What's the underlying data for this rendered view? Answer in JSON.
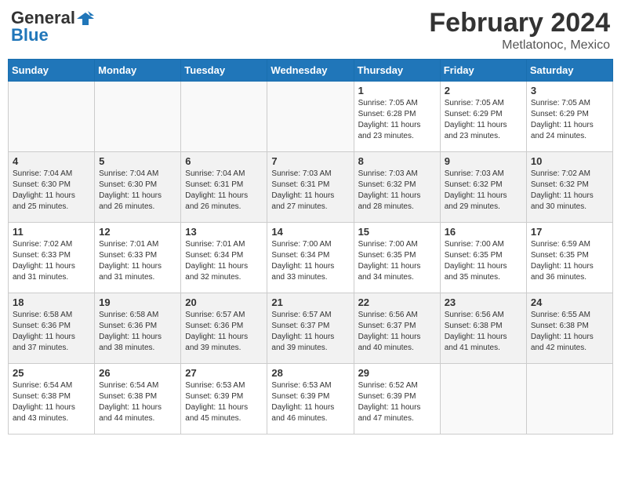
{
  "header": {
    "logo_line1": "General",
    "logo_line2": "Blue",
    "month_year": "February 2024",
    "location": "Metlatonoc, Mexico"
  },
  "weekdays": [
    "Sunday",
    "Monday",
    "Tuesday",
    "Wednesday",
    "Thursday",
    "Friday",
    "Saturday"
  ],
  "weeks": [
    [
      {
        "day": "",
        "info": ""
      },
      {
        "day": "",
        "info": ""
      },
      {
        "day": "",
        "info": ""
      },
      {
        "day": "",
        "info": ""
      },
      {
        "day": "1",
        "info": "Sunrise: 7:05 AM\nSunset: 6:28 PM\nDaylight: 11 hours\nand 23 minutes."
      },
      {
        "day": "2",
        "info": "Sunrise: 7:05 AM\nSunset: 6:29 PM\nDaylight: 11 hours\nand 23 minutes."
      },
      {
        "day": "3",
        "info": "Sunrise: 7:05 AM\nSunset: 6:29 PM\nDaylight: 11 hours\nand 24 minutes."
      }
    ],
    [
      {
        "day": "4",
        "info": "Sunrise: 7:04 AM\nSunset: 6:30 PM\nDaylight: 11 hours\nand 25 minutes."
      },
      {
        "day": "5",
        "info": "Sunrise: 7:04 AM\nSunset: 6:30 PM\nDaylight: 11 hours\nand 26 minutes."
      },
      {
        "day": "6",
        "info": "Sunrise: 7:04 AM\nSunset: 6:31 PM\nDaylight: 11 hours\nand 26 minutes."
      },
      {
        "day": "7",
        "info": "Sunrise: 7:03 AM\nSunset: 6:31 PM\nDaylight: 11 hours\nand 27 minutes."
      },
      {
        "day": "8",
        "info": "Sunrise: 7:03 AM\nSunset: 6:32 PM\nDaylight: 11 hours\nand 28 minutes."
      },
      {
        "day": "9",
        "info": "Sunrise: 7:03 AM\nSunset: 6:32 PM\nDaylight: 11 hours\nand 29 minutes."
      },
      {
        "day": "10",
        "info": "Sunrise: 7:02 AM\nSunset: 6:32 PM\nDaylight: 11 hours\nand 30 minutes."
      }
    ],
    [
      {
        "day": "11",
        "info": "Sunrise: 7:02 AM\nSunset: 6:33 PM\nDaylight: 11 hours\nand 31 minutes."
      },
      {
        "day": "12",
        "info": "Sunrise: 7:01 AM\nSunset: 6:33 PM\nDaylight: 11 hours\nand 31 minutes."
      },
      {
        "day": "13",
        "info": "Sunrise: 7:01 AM\nSunset: 6:34 PM\nDaylight: 11 hours\nand 32 minutes."
      },
      {
        "day": "14",
        "info": "Sunrise: 7:00 AM\nSunset: 6:34 PM\nDaylight: 11 hours\nand 33 minutes."
      },
      {
        "day": "15",
        "info": "Sunrise: 7:00 AM\nSunset: 6:35 PM\nDaylight: 11 hours\nand 34 minutes."
      },
      {
        "day": "16",
        "info": "Sunrise: 7:00 AM\nSunset: 6:35 PM\nDaylight: 11 hours\nand 35 minutes."
      },
      {
        "day": "17",
        "info": "Sunrise: 6:59 AM\nSunset: 6:35 PM\nDaylight: 11 hours\nand 36 minutes."
      }
    ],
    [
      {
        "day": "18",
        "info": "Sunrise: 6:58 AM\nSunset: 6:36 PM\nDaylight: 11 hours\nand 37 minutes."
      },
      {
        "day": "19",
        "info": "Sunrise: 6:58 AM\nSunset: 6:36 PM\nDaylight: 11 hours\nand 38 minutes."
      },
      {
        "day": "20",
        "info": "Sunrise: 6:57 AM\nSunset: 6:36 PM\nDaylight: 11 hours\nand 39 minutes."
      },
      {
        "day": "21",
        "info": "Sunrise: 6:57 AM\nSunset: 6:37 PM\nDaylight: 11 hours\nand 39 minutes."
      },
      {
        "day": "22",
        "info": "Sunrise: 6:56 AM\nSunset: 6:37 PM\nDaylight: 11 hours\nand 40 minutes."
      },
      {
        "day": "23",
        "info": "Sunrise: 6:56 AM\nSunset: 6:38 PM\nDaylight: 11 hours\nand 41 minutes."
      },
      {
        "day": "24",
        "info": "Sunrise: 6:55 AM\nSunset: 6:38 PM\nDaylight: 11 hours\nand 42 minutes."
      }
    ],
    [
      {
        "day": "25",
        "info": "Sunrise: 6:54 AM\nSunset: 6:38 PM\nDaylight: 11 hours\nand 43 minutes."
      },
      {
        "day": "26",
        "info": "Sunrise: 6:54 AM\nSunset: 6:38 PM\nDaylight: 11 hours\nand 44 minutes."
      },
      {
        "day": "27",
        "info": "Sunrise: 6:53 AM\nSunset: 6:39 PM\nDaylight: 11 hours\nand 45 minutes."
      },
      {
        "day": "28",
        "info": "Sunrise: 6:53 AM\nSunset: 6:39 PM\nDaylight: 11 hours\nand 46 minutes."
      },
      {
        "day": "29",
        "info": "Sunrise: 6:52 AM\nSunset: 6:39 PM\nDaylight: 11 hours\nand 47 minutes."
      },
      {
        "day": "",
        "info": ""
      },
      {
        "day": "",
        "info": ""
      }
    ]
  ]
}
